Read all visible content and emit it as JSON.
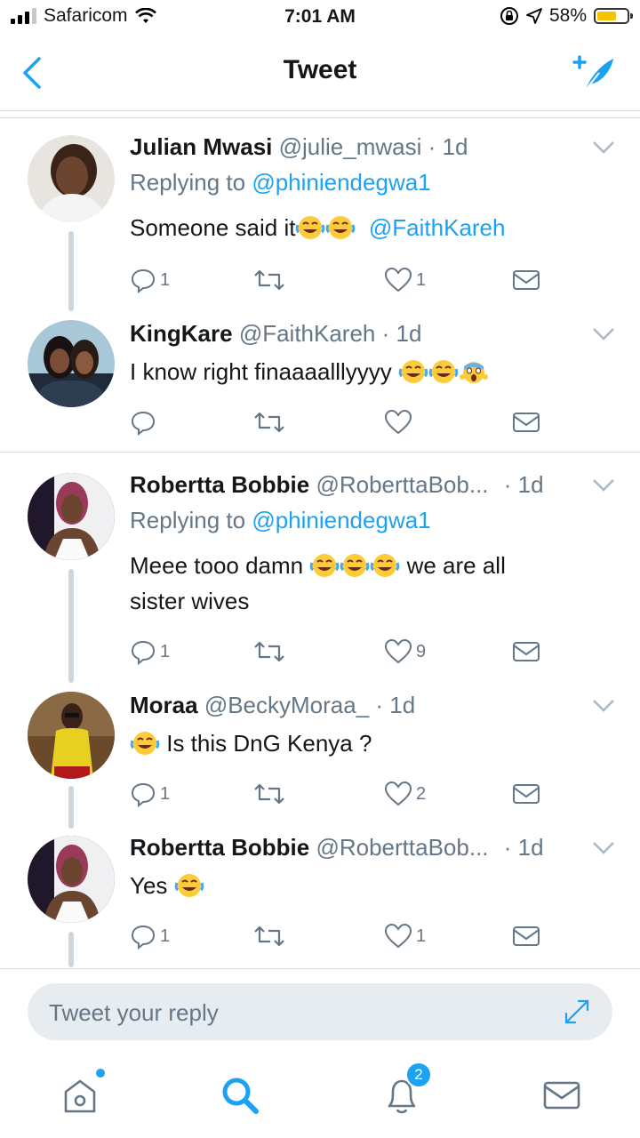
{
  "status": {
    "carrier": "Safaricom",
    "time": "7:01 AM",
    "battery": "58%"
  },
  "nav": {
    "title": "Tweet"
  },
  "tweets": [
    {
      "name": "Julian Mwasi",
      "handle": "@julie_mwasi",
      "time": "· 1d",
      "replying_prefix": "Replying to ",
      "replying_to": "@phiniendegwa1",
      "text": "Someone said it",
      "mention": "@FaithKareh",
      "replies": "1",
      "retweets": "",
      "likes": "1",
      "avatar_colors": [
        "#c9a98a",
        "#3a2418"
      ]
    },
    {
      "name": "KingKare",
      "handle": "@FaithKareh",
      "time": "· 1d",
      "text": "I know right finaaaalllyyyy ",
      "replies": "",
      "retweets": "",
      "likes": "",
      "avatar_colors": [
        "#a8c8d8",
        "#1f2a3a"
      ]
    },
    {
      "name": "Robertta Bobbie",
      "handle": "@RoberttaBob...",
      "time": "· 1d",
      "replying_prefix": "Replying to ",
      "replying_to": "@phiniendegwa1",
      "text_line1": "Meee tooo damn ",
      "text_line1_after": " we are all",
      "text_line2": "sister wives",
      "replies": "1",
      "retweets": "",
      "likes": "9",
      "avatar_colors": [
        "#20182a",
        "#c9a07a"
      ]
    },
    {
      "name": "Moraa",
      "handle": "@BeckyMoraa_",
      "time": "· 1d",
      "text": " Is this DnG Kenya ?",
      "replies": "1",
      "retweets": "",
      "likes": "2",
      "avatar_colors": [
        "#6a4a2a",
        "#e8d020"
      ]
    },
    {
      "name": "Robertta Bobbie",
      "handle": "@RoberttaBob...",
      "time": "· 1d",
      "text": "Yes ",
      "replies": "1",
      "retweets": "",
      "likes": "1",
      "avatar_colors": [
        "#20182a",
        "#c9a07a"
      ]
    }
  ],
  "reply_bar": {
    "placeholder": "Tweet your reply"
  },
  "tabbar": {
    "notifications_badge": "2"
  },
  "colors": {
    "accent": "#1da1f2",
    "secondary_text": "#657786",
    "divider": "#d8dde1"
  }
}
